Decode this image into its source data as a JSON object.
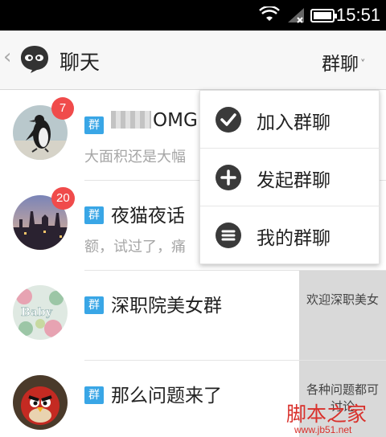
{
  "status_bar": {
    "time": "15:51"
  },
  "header": {
    "back_icon": "chevron-left-icon",
    "title": "聊天",
    "group_switch_label": "群聊",
    "chevron": "˅"
  },
  "conversations": [
    {
      "avatar": "penguin",
      "badge": "7",
      "tag": "群",
      "name": "OMG",
      "name_obscured": true,
      "preview": "大面积还是大幅"
    },
    {
      "avatar": "city-night",
      "badge": "20",
      "tag": "群",
      "name": "夜猫夜话",
      "preview": "额，试过了，痛"
    },
    {
      "avatar": "baby-flowers",
      "tag": "群",
      "name": "深职院美女群",
      "swipe_text": "欢迎深职美女"
    },
    {
      "avatar": "angry-bird",
      "tag": "群",
      "name": "那么问题来了",
      "swipe_text": "各种问题都可讨论"
    }
  ],
  "group_menu": [
    {
      "icon": "check-circle-icon",
      "label": "加入群聊"
    },
    {
      "icon": "plus-circle-icon",
      "label": "发起群聊"
    },
    {
      "icon": "list-circle-icon",
      "label": "我的群聊"
    }
  ],
  "watermark": {
    "brand": "脚本之家",
    "url": "www.jb51.net"
  },
  "colors": {
    "badge": "#f04b4b",
    "group_tag": "#39a6e6",
    "menu_icon": "#3a3a3a"
  }
}
